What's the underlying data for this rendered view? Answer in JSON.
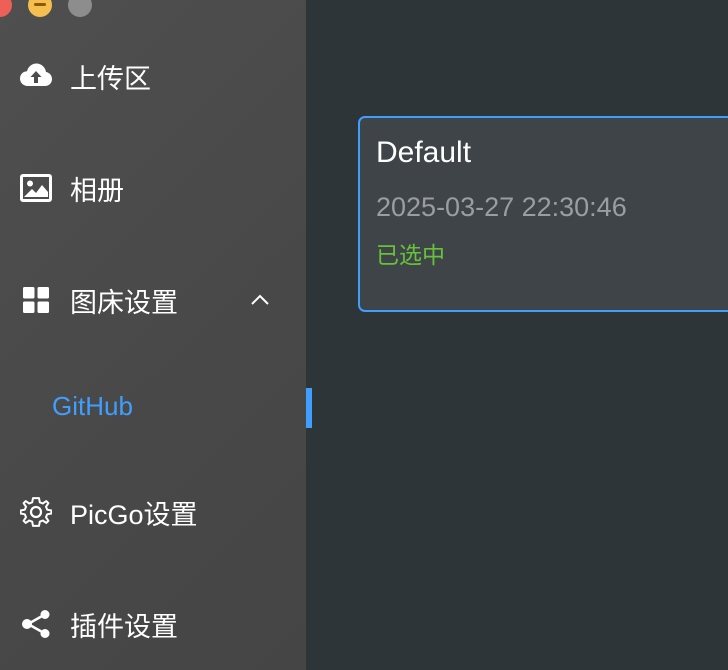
{
  "window": {
    "controls": [
      "close",
      "minimize",
      "zoom"
    ]
  },
  "sidebar": {
    "items": [
      {
        "label": "上传区",
        "icon": "cloud-upload-icon"
      },
      {
        "label": "相册",
        "icon": "image-icon"
      },
      {
        "label": "图床设置",
        "icon": "grid-icon",
        "expanded": true,
        "children": [
          {
            "label": "GitHub",
            "active": true
          }
        ]
      },
      {
        "label": "PicGo设置",
        "icon": "gear-icon"
      },
      {
        "label": "插件设置",
        "icon": "share-icon"
      }
    ]
  },
  "main": {
    "config_card": {
      "name": "Default",
      "timestamp": "2025-03-27 22:30:46",
      "status": "已选中",
      "selected": true
    }
  },
  "colors": {
    "accent": "#409eff",
    "success": "#67c23a",
    "sidebar_bg": "#4a4a4a",
    "main_bg": "#2e3539"
  }
}
